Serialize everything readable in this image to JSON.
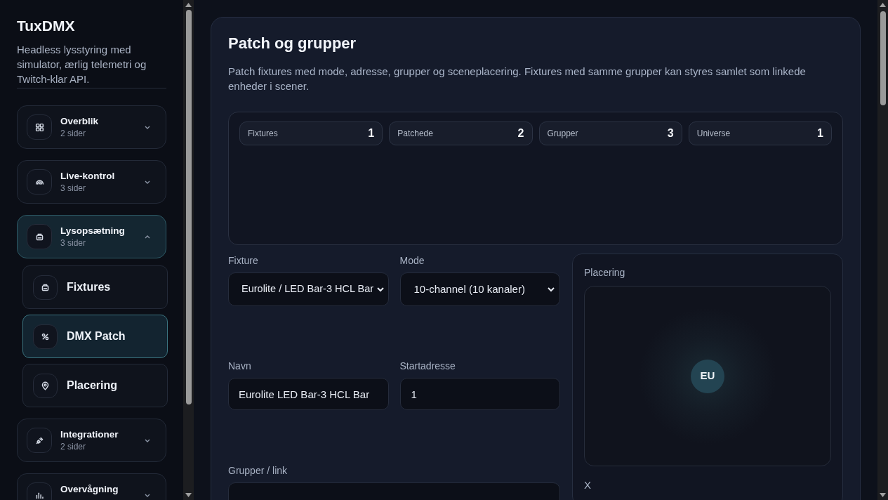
{
  "app": {
    "title": "TuxDMX",
    "tagline": "Headless lysstyring med simulator, ærlig telemetri og Twitch-klar API."
  },
  "nav": [
    {
      "kind": "grid",
      "label": "Overblik",
      "sub": "2 sider",
      "expanded": false,
      "selected": false
    },
    {
      "kind": "signal",
      "label": "Live-kontrol",
      "sub": "3 sider",
      "expanded": false,
      "selected": false
    },
    {
      "kind": "fixture",
      "label": "Lysopsætning",
      "sub": "3 sider",
      "expanded": true,
      "selected": true,
      "children": [
        {
          "kind": "fixture",
          "label": "Fixtures",
          "selected": false
        },
        {
          "kind": "patch",
          "label": "DMX Patch",
          "selected": true
        },
        {
          "kind": "pin",
          "label": "Placering",
          "selected": false
        }
      ]
    },
    {
      "kind": "plug",
      "label": "Integrationer",
      "sub": "2 sider",
      "expanded": false,
      "selected": false
    },
    {
      "kind": "bars",
      "label": "Overvågning",
      "expanded": false,
      "selected": false
    }
  ],
  "page": {
    "title": "Patch og grupper",
    "description": "Patch fixtures med mode, adresse, grupper og sceneplacering. Fixtures med samme grupper kan styres samlet som linkede enheder i scener.",
    "stats": [
      {
        "label": "Fixtures",
        "value": "1"
      },
      {
        "label": "Patchede",
        "value": "2"
      },
      {
        "label": "Grupper",
        "value": "3"
      },
      {
        "label": "Universe",
        "value": "1"
      }
    ],
    "form": {
      "fixture": {
        "label": "Fixture",
        "value": "Eurolite / LED Bar-3 HCL Bar"
      },
      "mode": {
        "label": "Mode",
        "value": "10-channel (10 kanaler)"
      },
      "name": {
        "label": "Navn",
        "value": "Eurolite LED Bar-3 HCL Bar"
      },
      "start_address": {
        "label": "Startadresse",
        "value": "1"
      },
      "groups": {
        "label": "Grupper / link"
      }
    },
    "placement": {
      "label": "Placering",
      "marker": "EU",
      "x_label": "X"
    }
  }
}
